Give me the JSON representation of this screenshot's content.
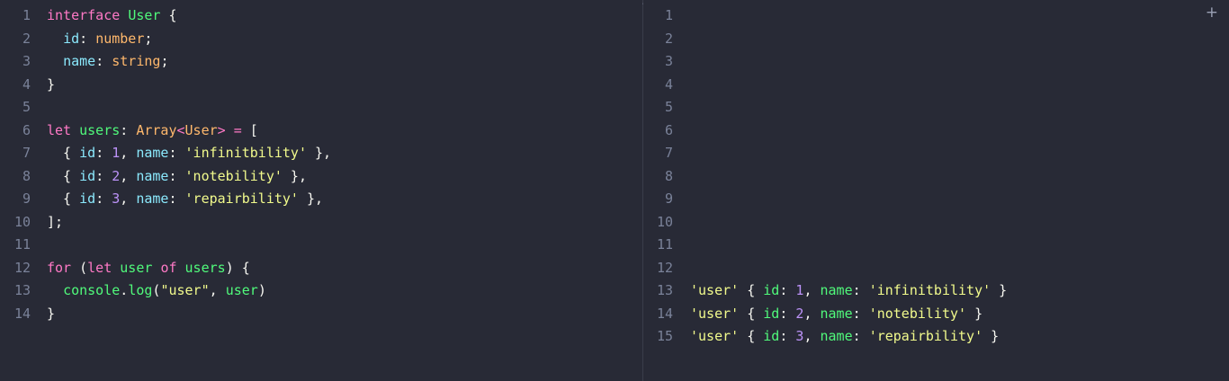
{
  "theme": {
    "keyword": "#ff79c6",
    "type": "#f1fa8c",
    "type_orange": "#ffb86c",
    "property": "#8be9fd",
    "string": "#f1fa8c",
    "number": "#bd93f9",
    "plain": "#f8f8f2",
    "func": "#50fa7b",
    "output_key": "#50fa7b"
  },
  "divider_glyph": "⁄",
  "add_tab_label": "+",
  "editor": {
    "lines": [
      {
        "n": "1",
        "tokens": [
          [
            "interface",
            "keyword"
          ],
          [
            " ",
            "plain"
          ],
          [
            "User",
            "func"
          ],
          [
            " {",
            "plain"
          ]
        ]
      },
      {
        "n": "2",
        "tokens": [
          [
            "  ",
            "plain"
          ],
          [
            "id",
            "property"
          ],
          [
            ": ",
            "plain"
          ],
          [
            "number",
            "type_orange"
          ],
          [
            ";",
            "plain"
          ]
        ]
      },
      {
        "n": "3",
        "tokens": [
          [
            "  ",
            "plain"
          ],
          [
            "name",
            "property"
          ],
          [
            ": ",
            "plain"
          ],
          [
            "string",
            "type_orange"
          ],
          [
            ";",
            "plain"
          ]
        ]
      },
      {
        "n": "4",
        "tokens": [
          [
            "}",
            "plain"
          ]
        ]
      },
      {
        "n": "5",
        "tokens": []
      },
      {
        "n": "6",
        "tokens": [
          [
            "let",
            "keyword"
          ],
          [
            " ",
            "plain"
          ],
          [
            "users",
            "func"
          ],
          [
            ": ",
            "plain"
          ],
          [
            "Array",
            "type_orange"
          ],
          [
            "<",
            "keyword"
          ],
          [
            "User",
            "type_orange"
          ],
          [
            "> = ",
            "keyword"
          ],
          [
            "[",
            "plain"
          ]
        ]
      },
      {
        "n": "7",
        "tokens": [
          [
            "  { ",
            "plain"
          ],
          [
            "id",
            "property"
          ],
          [
            ": ",
            "plain"
          ],
          [
            "1",
            "number"
          ],
          [
            ", ",
            "plain"
          ],
          [
            "name",
            "property"
          ],
          [
            ": ",
            "plain"
          ],
          [
            "'infinitbility'",
            "string"
          ],
          [
            " },",
            "plain"
          ]
        ]
      },
      {
        "n": "8",
        "tokens": [
          [
            "  { ",
            "plain"
          ],
          [
            "id",
            "property"
          ],
          [
            ": ",
            "plain"
          ],
          [
            "2",
            "number"
          ],
          [
            ", ",
            "plain"
          ],
          [
            "name",
            "property"
          ],
          [
            ": ",
            "plain"
          ],
          [
            "'notebility'",
            "string"
          ],
          [
            " },",
            "plain"
          ]
        ]
      },
      {
        "n": "9",
        "tokens": [
          [
            "  { ",
            "plain"
          ],
          [
            "id",
            "property"
          ],
          [
            ": ",
            "plain"
          ],
          [
            "3",
            "number"
          ],
          [
            ", ",
            "plain"
          ],
          [
            "name",
            "property"
          ],
          [
            ": ",
            "plain"
          ],
          [
            "'repairbility'",
            "string"
          ],
          [
            " },",
            "plain"
          ]
        ]
      },
      {
        "n": "10",
        "tokens": [
          [
            "];",
            "plain"
          ]
        ]
      },
      {
        "n": "11",
        "tokens": []
      },
      {
        "n": "12",
        "tokens": [
          [
            "for",
            "keyword"
          ],
          [
            " (",
            "plain"
          ],
          [
            "let",
            "keyword"
          ],
          [
            " ",
            "plain"
          ],
          [
            "user",
            "func"
          ],
          [
            " ",
            "plain"
          ],
          [
            "of",
            "keyword"
          ],
          [
            " ",
            "plain"
          ],
          [
            "users",
            "func"
          ],
          [
            ") {",
            "plain"
          ]
        ]
      },
      {
        "n": "13",
        "tokens": [
          [
            "  ",
            "plain"
          ],
          [
            "console",
            "func"
          ],
          [
            ".",
            "plain"
          ],
          [
            "log",
            "func"
          ],
          [
            "(",
            "plain"
          ],
          [
            "\"user\"",
            "string"
          ],
          [
            ", ",
            "plain"
          ],
          [
            "user",
            "func"
          ],
          [
            ")",
            "plain"
          ]
        ]
      },
      {
        "n": "14",
        "tokens": [
          [
            "}",
            "plain"
          ]
        ]
      }
    ]
  },
  "output": {
    "lines": [
      {
        "n": "1",
        "tokens": []
      },
      {
        "n": "2",
        "tokens": []
      },
      {
        "n": "3",
        "tokens": []
      },
      {
        "n": "4",
        "tokens": []
      },
      {
        "n": "5",
        "tokens": []
      },
      {
        "n": "6",
        "tokens": []
      },
      {
        "n": "7",
        "tokens": []
      },
      {
        "n": "8",
        "tokens": []
      },
      {
        "n": "9",
        "tokens": []
      },
      {
        "n": "10",
        "tokens": []
      },
      {
        "n": "11",
        "tokens": []
      },
      {
        "n": "12",
        "tokens": []
      },
      {
        "n": "13",
        "tokens": [
          [
            "'user'",
            "string"
          ],
          [
            " { ",
            "plain"
          ],
          [
            "id",
            "output_key"
          ],
          [
            ": ",
            "plain"
          ],
          [
            "1",
            "number"
          ],
          [
            ", ",
            "plain"
          ],
          [
            "name",
            "output_key"
          ],
          [
            ": ",
            "plain"
          ],
          [
            "'infinitbility'",
            "string"
          ],
          [
            " }",
            "plain"
          ]
        ]
      },
      {
        "n": "14",
        "tokens": [
          [
            "'user'",
            "string"
          ],
          [
            " { ",
            "plain"
          ],
          [
            "id",
            "output_key"
          ],
          [
            ": ",
            "plain"
          ],
          [
            "2",
            "number"
          ],
          [
            ", ",
            "plain"
          ],
          [
            "name",
            "output_key"
          ],
          [
            ": ",
            "plain"
          ],
          [
            "'notebility'",
            "string"
          ],
          [
            " }",
            "plain"
          ]
        ]
      },
      {
        "n": "15",
        "tokens": [
          [
            "'user'",
            "string"
          ],
          [
            " { ",
            "plain"
          ],
          [
            "id",
            "output_key"
          ],
          [
            ": ",
            "plain"
          ],
          [
            "3",
            "number"
          ],
          [
            ", ",
            "plain"
          ],
          [
            "name",
            "output_key"
          ],
          [
            ": ",
            "plain"
          ],
          [
            "'repairbility'",
            "string"
          ],
          [
            " }",
            "plain"
          ]
        ]
      }
    ]
  }
}
